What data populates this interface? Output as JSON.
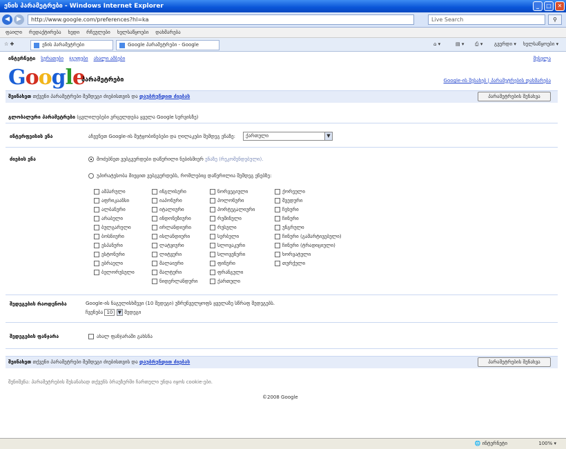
{
  "window": {
    "title": "ენის პარამეტრები - Windows Internet Explorer",
    "address": "http://www.google.com/preferences?hl=ka",
    "search_placeholder": "Live Search",
    "live_search": "Live Search"
  },
  "menu": [
    "ფაილი",
    "რედაქტირება",
    "ხედი",
    "რჩეულები",
    "ხელსაწყოები",
    "დახმარება"
  ],
  "tabs": [
    {
      "label": "ენის პარამეტრები"
    },
    {
      "label": "Google პარამეტრები - Google"
    }
  ],
  "commands": {
    "home": "⌂ ▾",
    "feeds": "▤ ▾",
    "print": "⎙ ▾",
    "page": "გვერდი ▾",
    "tools": "ხელსაწყოები ▾"
  },
  "top_nav": {
    "current": "ინტერნეტი",
    "links": [
      "სურათები",
      "ჯგუფები",
      "ახალი ამბები"
    ],
    "sign_in": "შესვლა"
  },
  "logo": {
    "letters": [
      "G",
      "o",
      "o",
      "g",
      "l",
      "e"
    ]
  },
  "page_title": "პარამეტრები",
  "right_links": "Google-ის შესახებ | პარამეტრების დახმარება",
  "save_bar_top": {
    "text_bold": "შეინახეთ",
    "text": " თქვენი პარამეტრები შემდეგი ძიებისთვის და ",
    "link": "დაუბრუნდით ძიებას",
    "button": "პარამეტრების შენახვა"
  },
  "global_prefs": {
    "bold": "გლობალური პარამეტრები",
    "text": " (ცვლილებები ვრცელდება ყველა Google სერვისზე)"
  },
  "interface_lang": {
    "label": "ინტერფეისის ენა",
    "desc": "აჩვენეთ Google-ის შეტყობინებები და ღილაკები შემდეგ ენაზე:",
    "selected": "ქართული"
  },
  "search_lang": {
    "label": "ძიების ენა",
    "option1": "მოძებნეთ ვებგვერდები დაწერილი ნებისმიერ ",
    "option1_light": "ენაზე (რეკომენდებული).",
    "option2": "უპირატესობა მიეცით ვებგვერდებს, რომლებიც დაწერილია შემდეგ ენებზე:"
  },
  "languages": [
    [
      "ამჰარული",
      "აფრიკაანსი",
      "ალბანური",
      "არაბული",
      "ბულგარული",
      "ბოსნიური",
      "ესპანური",
      "ესტონური",
      "ებრაული",
      "ბელორუსული"
    ],
    [
      "ინგლისური",
      "იაპონური",
      "იტალიური",
      "ინდონეზიური",
      "ირლანდიური",
      "ისლანდიური",
      "ლატვიური",
      "ლიტვური",
      "მალაიური",
      "მალტური",
      "ნიდერლანდური"
    ],
    [
      "ნორვეგიული",
      "პოლონური",
      "პორტუგალიური",
      "რუმინული",
      "რუსული",
      "სერბული",
      "სლოვაკური",
      "სლოვენური",
      "ფინური",
      "ფრანგული",
      "ქართული"
    ],
    [
      "ქორეული",
      "შვედური",
      "ჩეხური",
      "ჩინური",
      "უნგრული",
      "ჩინური (გამარტივებული)",
      "ჩინური (ტრადიციული)",
      "ხორვატული",
      "თურქული"
    ]
  ],
  "results_count": {
    "label": "შედეგების რაოდენობა",
    "text1": "Google-ის ნაგულისხმევი (10 შედეგი) უზრუნველყოფს ყველაზე სწრაფ შედეგებს.",
    "text2": "ჩვენება",
    "value": "10",
    "text3": "შედეგი"
  },
  "results_window": {
    "label": "შედეგების ფანჯარა",
    "text": "ახალ ფანჯარაში გახსნა"
  },
  "save_bar_bottom": {
    "text_bold": "შეინახეთ",
    "text": " თქვენი პარამეტრები შემდეგი ძიებისთვის და ",
    "link": "დაუბრუნდით ძიებას",
    "button": "პარამეტრების შენახვა"
  },
  "footnote": "შენიშვნა: პარამეტრების შესანახად თქვენს ბრაუზერში ჩართული უნდა იყოს cookie-ები.",
  "copyright": "©2008 Google",
  "status": {
    "zone": "ინტერნეტი",
    "zoom": "100% ▾"
  },
  "colors": {
    "logo": [
      "#1a5fd6",
      "#d22e1f",
      "#f2b51a",
      "#1a5fd6",
      "#2a9a2a",
      "#d22e1f"
    ]
  }
}
